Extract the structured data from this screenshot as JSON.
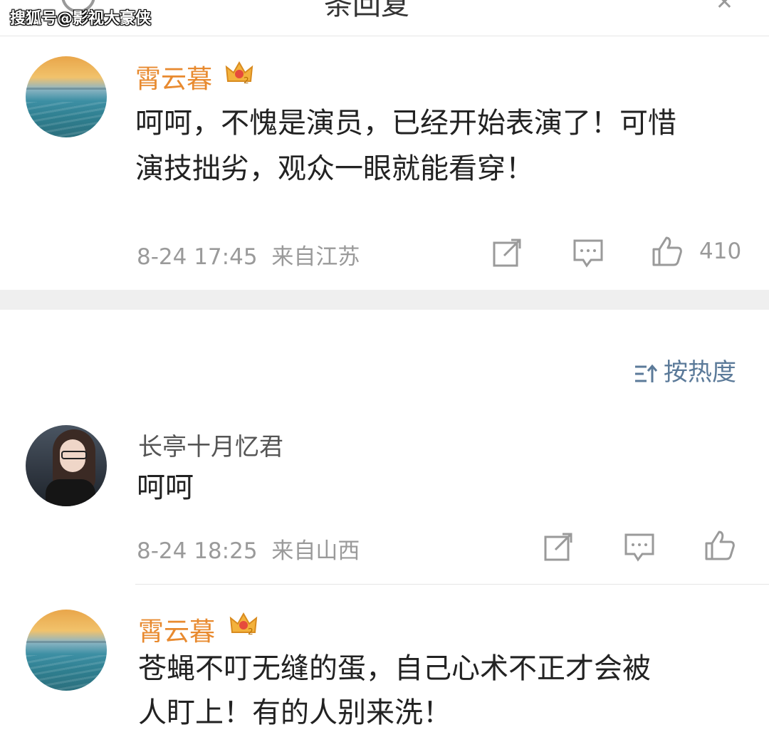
{
  "watermark": "搜狐号@影视大豪侠",
  "top": {
    "title": "条回复"
  },
  "sort": {
    "label": "按热度"
  },
  "comments": [
    {
      "username": "霄云暮",
      "text_lines": [
        "呵呵，不愧是演员，已经开始表演了！可惜",
        "演技拙劣，观众一眼就能看穿！"
      ],
      "time": "8-24 17:45",
      "location": "来自江苏",
      "likes": "410",
      "avatar_icon": "sea-avatar",
      "badge_icon": "crown-badge-icon"
    },
    {
      "username": "长亭十月忆君",
      "text_lines": [
        "呵呵"
      ],
      "time": "8-24 18:25",
      "location": "来自山西",
      "likes": "",
      "avatar_icon": "girl-avatar"
    },
    {
      "username": "霄云暮",
      "text_lines": [
        "苍蝇不叮无缝的蛋，自己心术不正才会被",
        "人盯上！有的人别来洗！"
      ],
      "avatar_icon": "sea-avatar",
      "badge_icon": "crown-badge-icon"
    }
  ],
  "colors": {
    "vip_name": "#e88a2f",
    "meta": "#9a9a9a",
    "sort": "#5b7a99",
    "band": "#efefef"
  }
}
